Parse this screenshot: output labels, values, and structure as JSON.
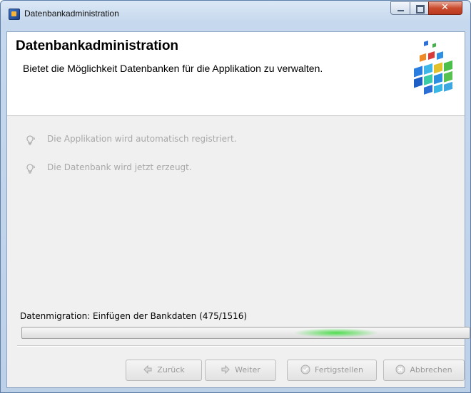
{
  "window": {
    "title": "Datenbankadministration"
  },
  "header": {
    "title": "Datenbankadministration",
    "description": "Bietet die Möglichkeit Datenbanken für die Applikation zu verwalten."
  },
  "steps": [
    {
      "label": "Die Applikation wird automatisch registriert.",
      "icon": "lightbulb-icon"
    },
    {
      "label": "Die Datenbank wird jetzt erzeugt.",
      "icon": "lightbulb-icon"
    }
  ],
  "status": {
    "text": "Datenmigration: Einfügen der Bankdaten (475/1516)",
    "progress_current": 475,
    "progress_total": 1516,
    "indeterminate": true,
    "accent_color": "#3fd83f"
  },
  "buttons": {
    "back": "Zurück",
    "next": "Weiter",
    "finish": "Fertigstellen",
    "cancel": "Abbrechen"
  }
}
